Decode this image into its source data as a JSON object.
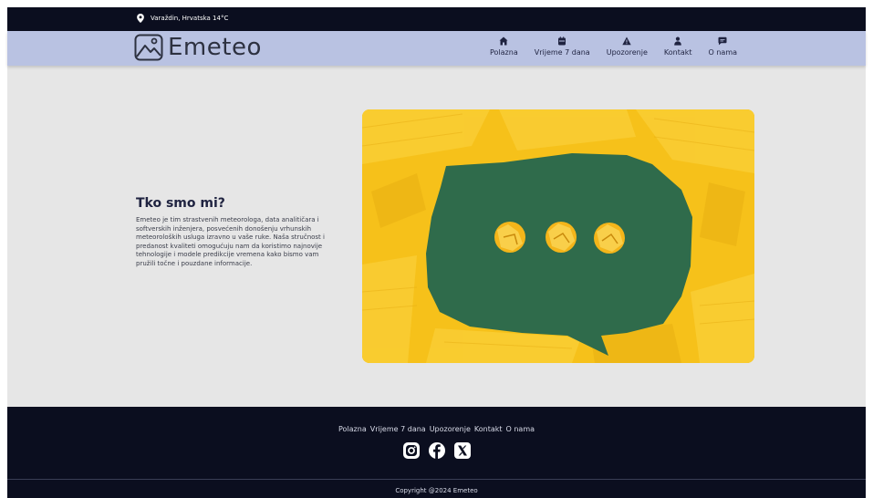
{
  "topbar": {
    "location": "Varaždin, Hrvatska 14°C",
    "icon": "location-pin-icon"
  },
  "brand": {
    "name": "Emeteo",
    "icon": "mountain-photo-logo"
  },
  "nav": [
    {
      "label": "Polazna",
      "icon": "home-icon"
    },
    {
      "label": "Vrijeme 7 dana",
      "icon": "calendar-icon"
    },
    {
      "label": "Upozorenje",
      "icon": "warning-icon"
    },
    {
      "label": "Kontakt",
      "icon": "person-icon"
    },
    {
      "label": "O nama",
      "icon": "chat-icon"
    }
  ],
  "about": {
    "title": "Tko smo mi?",
    "text": "Emeteo je tim strastvenih meteorologa, data analitičara i softverskih  inženjera, posvećenih donošenju vrhunskih meteoroloških usluga izravno u vaše ruke. Naša stručnost i predanost kvaliteti omogućuju nam da  koristimo najnovije tehnologije i modele predikcije vremena kako bismo  vam pružili točne i pouzdane informacije."
  },
  "footer": {
    "links": [
      "Polazna",
      "Vrijeme 7 dana",
      "Upozorenje",
      "Kontakt",
      "O nama"
    ],
    "socials": [
      "instagram-icon",
      "facebook-icon",
      "x-icon"
    ],
    "copyright": "Copyright @2024 Emeteo"
  },
  "colors": {
    "dark": "#0b0e1f",
    "navbar": "#b9c2e2",
    "background": "#e6e6e6",
    "photo_yellow": "#f6c11a",
    "photo_green": "#2f6b4b"
  }
}
